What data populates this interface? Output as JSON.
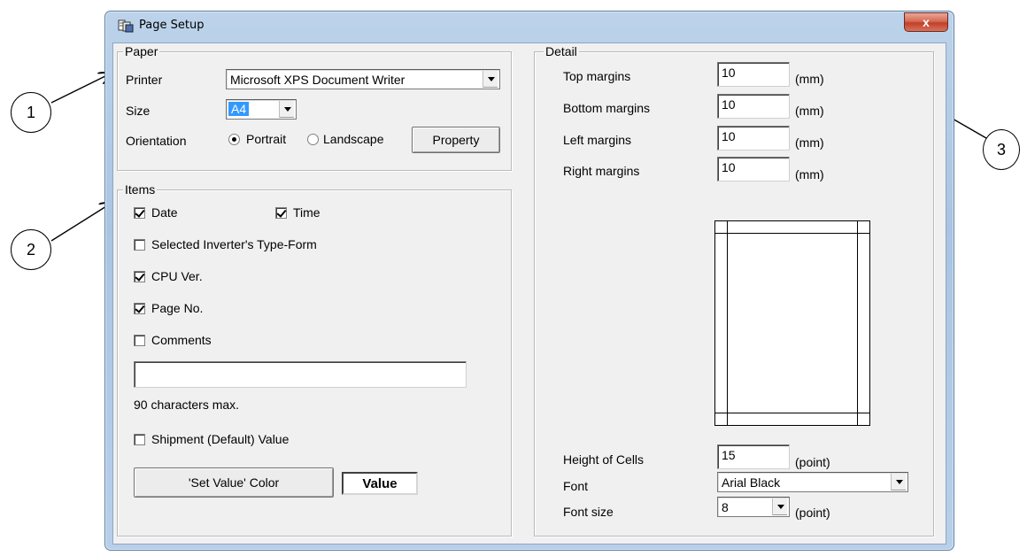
{
  "window": {
    "title": "Page Setup",
    "close_glyph": "x"
  },
  "callouts": [
    "1",
    "2",
    "3"
  ],
  "paper": {
    "legend": "Paper",
    "printer_label": "Printer",
    "printer_value": "Microsoft XPS Document Writer",
    "size_label": "Size",
    "size_value": "A4",
    "orientation_label": "Orientation",
    "portrait_label": "Portrait",
    "landscape_label": "Landscape",
    "orientation_selected": "Portrait",
    "property_button": "Property"
  },
  "items": {
    "legend": "Items",
    "date_label": "Date",
    "date_checked": true,
    "time_label": "Time",
    "time_checked": true,
    "inverter_label": "Selected Inverter's Type-Form",
    "inverter_checked": false,
    "cpu_label": "CPU Ver.",
    "cpu_checked": true,
    "page_label": "Page No.",
    "page_checked": true,
    "comments_label": "Comments",
    "comments_checked": false,
    "comments_value": "",
    "max_chars_note": "90 characters max.",
    "shipment_label": "Shipment (Default) Value",
    "shipment_checked": false,
    "set_value_color_button": "'Set Value' Color",
    "value_sample": "Value"
  },
  "detail": {
    "legend": "Detail",
    "top_label": "Top margins",
    "top_value": "10",
    "bottom_label": "Bottom margins",
    "bottom_value": "10",
    "left_label": "Left margins",
    "left_value": "10",
    "right_label": "Right margins",
    "right_value": "10",
    "mm_unit": "(mm)",
    "cell_height_label": "Height of Cells",
    "cell_height_value": "15",
    "point_unit": "(point)",
    "font_label": "Font",
    "font_value": "Arial Black",
    "font_size_label": "Font size",
    "font_size_value": "8"
  },
  "colors": {
    "titlebar": "#b9d1ea",
    "close_button": "#c94a34",
    "dialog_background": "#f0f0f0",
    "selection": "#3399ff"
  }
}
